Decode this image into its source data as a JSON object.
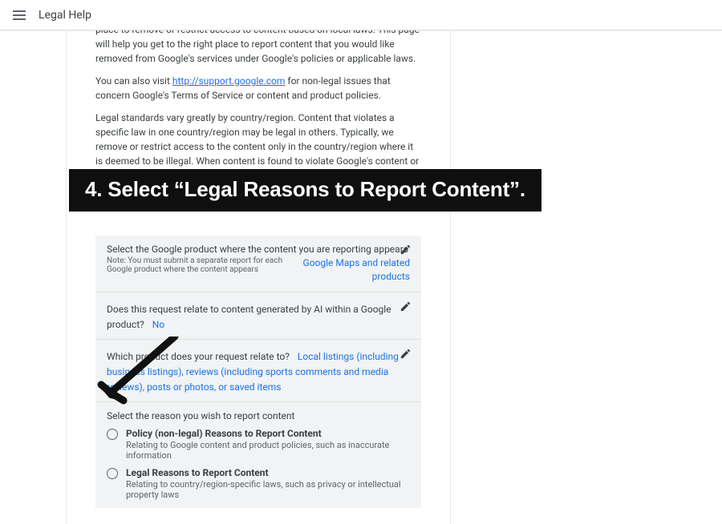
{
  "topbar": {
    "title": "Legal Help"
  },
  "paragraphs": {
    "p1_a": "place to remove or restrict access to content based on local laws. This page will help you get to the right place to report content that you would like removed from Google's services under Google's policies or applicable laws.",
    "p2_a": "You can also visit ",
    "p2_link": "http://support.google.com",
    "p2_b": " for non-legal issues that concern Google's Terms of Service or content and product policies.",
    "p3": "Legal standards vary greatly by country/region. Content that violates a specific law in one country/region may be legal in others. Typically, we remove or restrict access to the content only in the country/region where it is deemed to be illegal. When content is found to violate Google's content or product policies or Terms of"
  },
  "card": {
    "row1": {
      "q": "Select the Google product where the content you are reporting appears",
      "note_a": "Note: You must submit a separate report for each Google product where the content appears",
      "answer": "Google Maps and related products"
    },
    "row2": {
      "q": "Does this request relate to content generated by AI within a Google product?",
      "answer": "No"
    },
    "row3": {
      "q_a": "Which product does your request relate to?",
      "answer": "Local listings (including business listings), reviews (including sports comments and media reviews), posts or photos, or saved items"
    },
    "radios": {
      "title": "Select the reason you wish to report content",
      "opt1": {
        "label": "Policy (non-legal) Reasons to Report Content",
        "desc": "Relating to Google content and product policies, such as inaccurate information"
      },
      "opt2": {
        "label": "Legal Reasons to Report Content",
        "desc": "Relating to country/region-specific laws, such as privacy or intellectual property laws"
      }
    }
  },
  "overlay": {
    "step": "4. Select “Legal Reasons to Report Content”."
  }
}
